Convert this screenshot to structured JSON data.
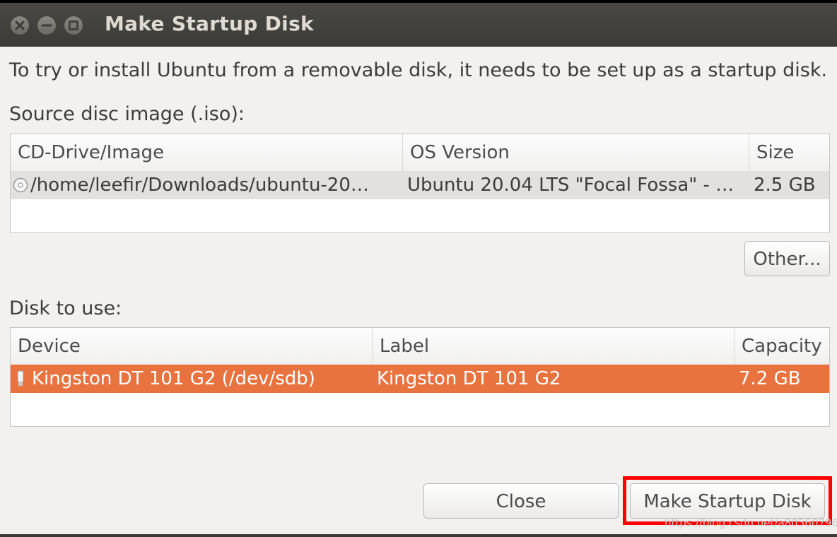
{
  "window": {
    "title": "Make Startup Disk",
    "controls": [
      "close-icon",
      "minimize-icon",
      "maximize-icon"
    ]
  },
  "intro_text": "To try or install Ubuntu from a removable disk, it needs to be set up as a startup disk.",
  "source": {
    "label": "Source disc image (.iso):",
    "columns": [
      "CD-Drive/Image",
      "OS Version",
      "Size"
    ],
    "rows": [
      {
        "icon": "cd-disc-icon",
        "image": "/home/leefir/Downloads/ubuntu-20…",
        "os_version": "Ubuntu 20.04 LTS \"Focal Fossa\" - …",
        "size": "2.5 GB"
      }
    ],
    "other_button": "Other..."
  },
  "disk": {
    "label": "Disk to use:",
    "columns": [
      "Device",
      "Label",
      "Capacity"
    ],
    "rows": [
      {
        "icon": "usb-drive-icon",
        "device": "Kingston DT 101 G2 (/dev/sdb)",
        "label": "Kingston DT 101 G2",
        "capacity": "7.2 GB",
        "selected": true
      }
    ]
  },
  "buttons": {
    "close": "Close",
    "make": "Make Startup Disk"
  },
  "watermark": "https://blog.csdn.net/a805607966",
  "colors": {
    "selection": "#e9733f",
    "highlight_box": "#ff0000",
    "titlebar": "#3c3b37"
  }
}
